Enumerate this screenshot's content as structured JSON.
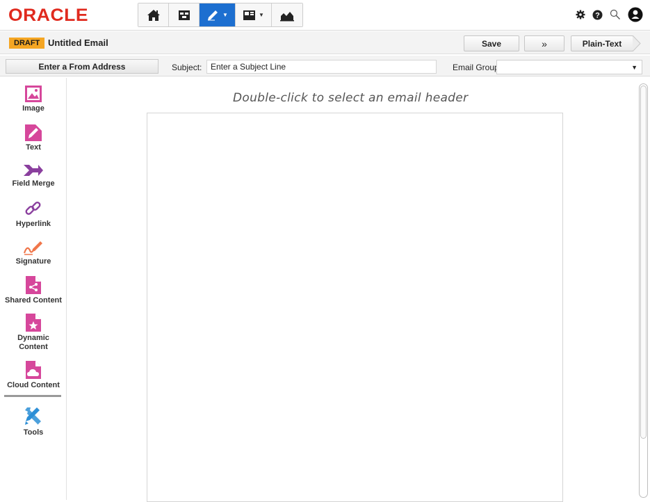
{
  "header": {
    "logo": "ORACLE",
    "nav": [
      {
        "icon": "home-icon"
      },
      {
        "icon": "campaign-icon"
      },
      {
        "icon": "edit-icon",
        "active": true
      },
      {
        "icon": "assets-icon"
      },
      {
        "icon": "reports-icon"
      }
    ],
    "right_icons": [
      "gear-icon",
      "help-icon",
      "search-icon",
      "user-icon"
    ]
  },
  "titlebar": {
    "badge": "DRAFT",
    "title": "Untitled Email",
    "save_label": "Save",
    "more_label": "»",
    "plaintext_label": "Plain-Text"
  },
  "fields": {
    "from_label": "Enter a From Address",
    "subject_label": "Subject:",
    "subject_value": "Enter a Subject Line",
    "group_label": "Email Group:",
    "group_value": ""
  },
  "sidebar": {
    "items": [
      {
        "label": "Image",
        "icon": "image-icon"
      },
      {
        "label": "Text",
        "icon": "text-icon"
      },
      {
        "label": "Field Merge",
        "icon": "field-merge-icon"
      },
      {
        "label": "Hyperlink",
        "icon": "hyperlink-icon"
      },
      {
        "label": "Signature",
        "icon": "signature-icon"
      },
      {
        "label": "Shared Content",
        "icon": "shared-content-icon"
      },
      {
        "label": "Dynamic\nContent",
        "icon": "dynamic-content-icon"
      },
      {
        "label": "Cloud Content",
        "icon": "cloud-content-icon"
      },
      {
        "label": "Tools",
        "icon": "tools-icon"
      }
    ]
  },
  "canvas": {
    "hint": "Double-click to select an email header"
  },
  "colors": {
    "brand": "#e02a1e",
    "active_nav": "#1d6fd0",
    "draft_badge": "#f5a623",
    "icon_pink": "#d6479b",
    "icon_purple": "#8a3f9e",
    "icon_orange": "#f0764a",
    "icon_blue": "#2d8fd6"
  }
}
